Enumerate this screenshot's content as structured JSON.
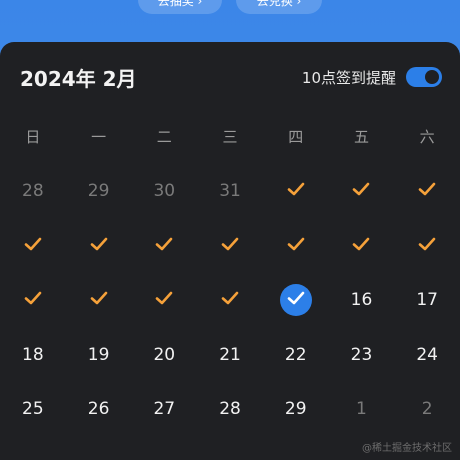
{
  "top_buttons": [
    {
      "label": "去抽奖 ›"
    },
    {
      "label": "去兑换 ›"
    }
  ],
  "calendar": {
    "title": "2024年 2月",
    "reminder_label": "10点签到提醒",
    "reminder_on": true,
    "weekdays": [
      "日",
      "一",
      "二",
      "三",
      "四",
      "五",
      "六"
    ],
    "weeks": [
      [
        {
          "type": "other",
          "label": "28"
        },
        {
          "type": "other",
          "label": "29"
        },
        {
          "type": "other",
          "label": "30"
        },
        {
          "type": "other",
          "label": "31"
        },
        {
          "type": "checked"
        },
        {
          "type": "checked"
        },
        {
          "type": "checked"
        }
      ],
      [
        {
          "type": "checked"
        },
        {
          "type": "checked"
        },
        {
          "type": "checked"
        },
        {
          "type": "checked"
        },
        {
          "type": "checked"
        },
        {
          "type": "checked"
        },
        {
          "type": "checked"
        }
      ],
      [
        {
          "type": "checked"
        },
        {
          "type": "checked"
        },
        {
          "type": "checked"
        },
        {
          "type": "checked"
        },
        {
          "type": "today"
        },
        {
          "type": "day",
          "label": "16"
        },
        {
          "type": "day",
          "label": "17"
        }
      ],
      [
        {
          "type": "day",
          "label": "18"
        },
        {
          "type": "day",
          "label": "19"
        },
        {
          "type": "day",
          "label": "20"
        },
        {
          "type": "day",
          "label": "21"
        },
        {
          "type": "day",
          "label": "22"
        },
        {
          "type": "day",
          "label": "23"
        },
        {
          "type": "day",
          "label": "24"
        }
      ],
      [
        {
          "type": "day",
          "label": "25"
        },
        {
          "type": "day",
          "label": "26"
        },
        {
          "type": "day",
          "label": "27"
        },
        {
          "type": "day",
          "label": "28"
        },
        {
          "type": "day",
          "label": "29"
        },
        {
          "type": "other",
          "label": "1"
        },
        {
          "type": "other",
          "label": "2"
        }
      ]
    ]
  },
  "colors": {
    "accent": "#2c7fe8",
    "check": "#f5a13a",
    "panel": "#1f2023"
  },
  "watermark": "@稀土掘金技术社区"
}
